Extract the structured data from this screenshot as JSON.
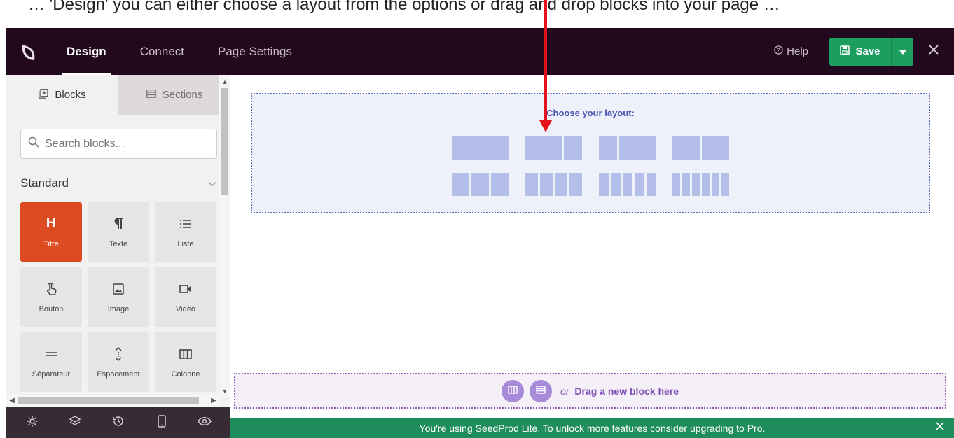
{
  "caption": "    … 'Design'  you can either choose a layout from the options or drag and drop blocks into your page …",
  "header": {
    "tabs": [
      {
        "label": "Design",
        "active": true
      },
      {
        "label": "Connect",
        "active": false
      },
      {
        "label": "Page Settings",
        "active": false
      }
    ],
    "help_label": "Help",
    "save_label": "Save"
  },
  "sidebar": {
    "tabs": [
      {
        "label": "Blocks",
        "active": true
      },
      {
        "label": "Sections",
        "active": false
      }
    ],
    "search_placeholder": "Search blocks...",
    "section_title": "Standard",
    "blocks": [
      {
        "label": "Titre",
        "icon": "heading-icon"
      },
      {
        "label": "Texte",
        "icon": "paragraph-icon"
      },
      {
        "label": "Liste",
        "icon": "list-icon"
      },
      {
        "label": "Bouton",
        "icon": "pointer-icon"
      },
      {
        "label": "Image",
        "icon": "image-icon"
      },
      {
        "label": "Vidéo",
        "icon": "video-icon"
      },
      {
        "label": "Séparateur",
        "icon": "divider-icon"
      },
      {
        "label": "Espacement",
        "icon": "spacer-icon"
      },
      {
        "label": "Colonne",
        "icon": "columns-icon"
      }
    ],
    "heading_block_letter": "H"
  },
  "bottom_bar": [
    "settings-icon",
    "layers-icon",
    "history-icon",
    "mobile-icon",
    "preview-icon"
  ],
  "canvas": {
    "layout_title": "Choose your layout:",
    "drop_or": "or",
    "drop_text": "Drag a new block here"
  },
  "notice": "You're using SeedProd Lite. To unlock more features consider upgrading to Pro.",
  "colors": {
    "topbar": "#23091e",
    "accent_save": "#1b9e5e",
    "active_block": "#dd4b22",
    "layout_border": "#5a66b8",
    "layout_fill": "#b3bee9",
    "drop_border": "#8d5db5",
    "notice": "#1e8c5b",
    "arrow": "#e3121a"
  }
}
